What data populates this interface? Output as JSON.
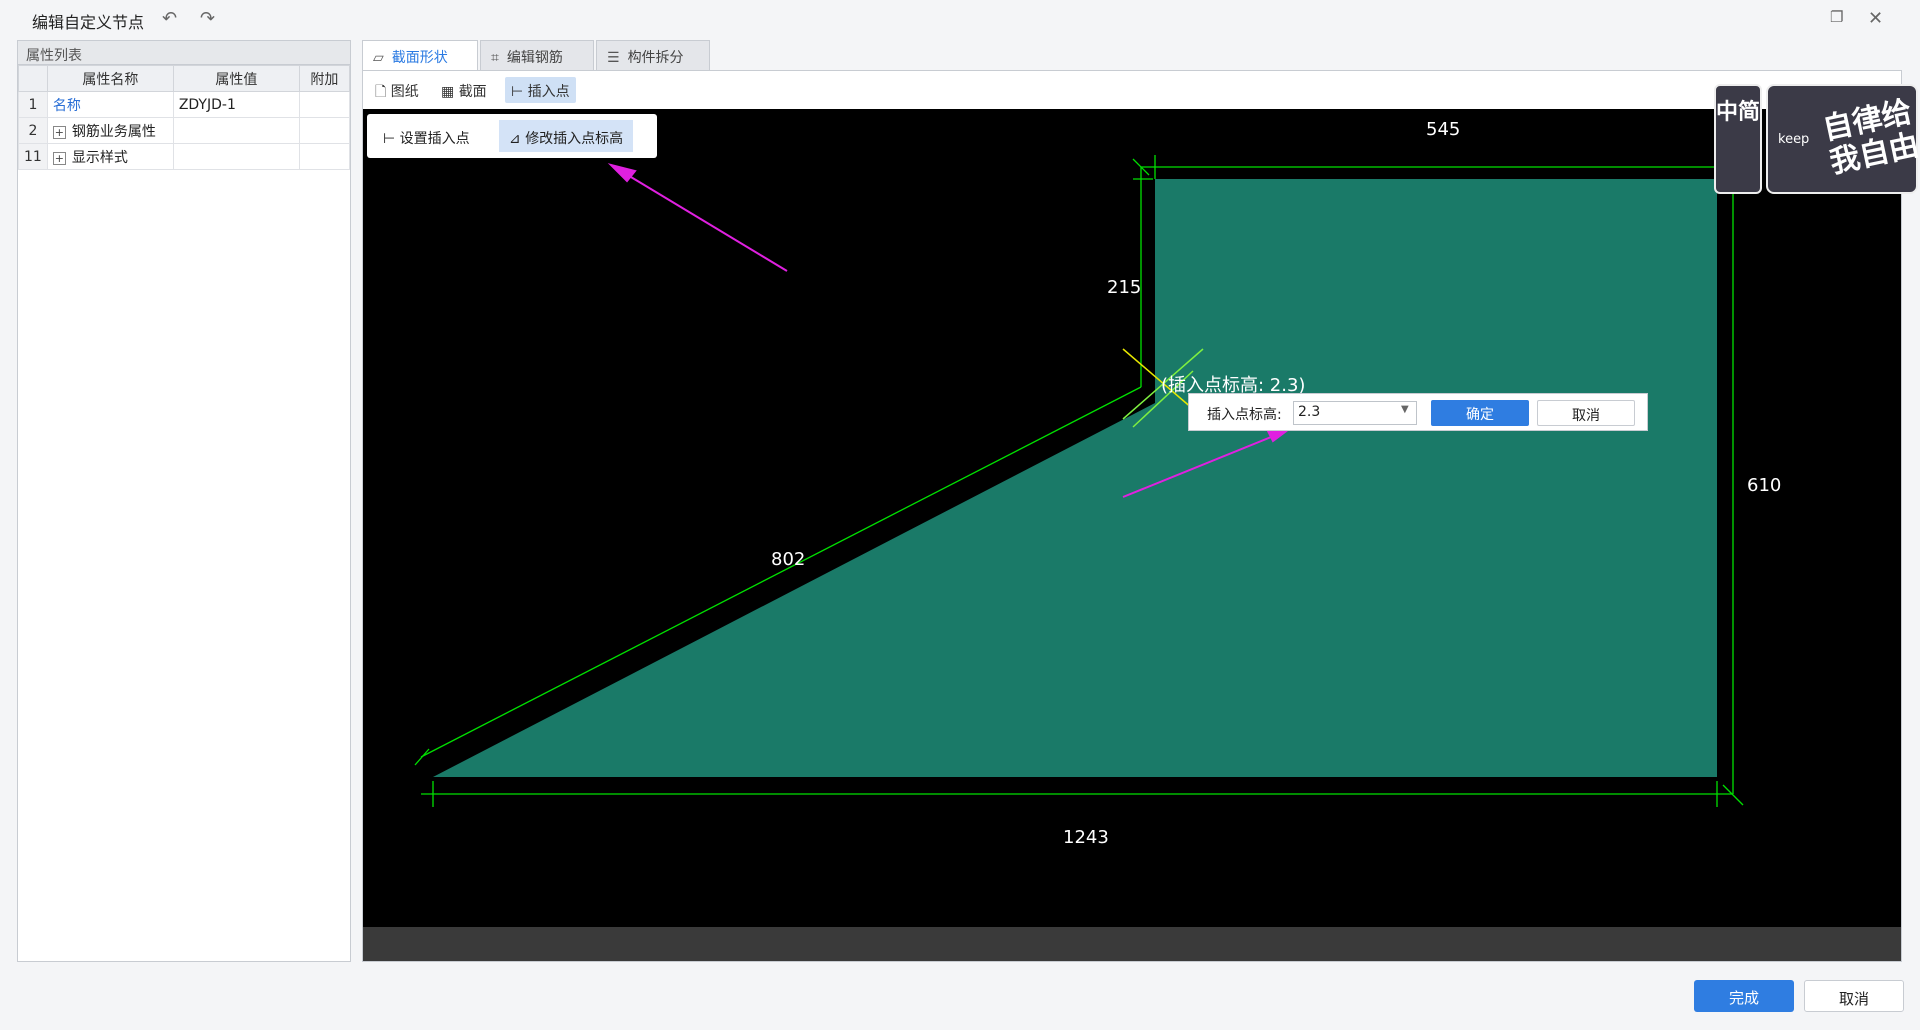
{
  "window": {
    "title": "编辑自定义节点",
    "undo_icon": "undo-icon",
    "redo_icon": "redo-icon",
    "restore_icon": "restore-icon",
    "close_icon": "close-icon"
  },
  "property_panel": {
    "title": "属性列表",
    "columns": [
      "属性名称",
      "属性值",
      "附加"
    ],
    "rows": [
      {
        "no": "1",
        "name": "名称",
        "value": "ZDYJD-1",
        "expand": ""
      },
      {
        "no": "2",
        "name": "钢筋业务属性",
        "value": "",
        "expand": "+"
      },
      {
        "no": "11",
        "name": "显示样式",
        "value": "",
        "expand": "+"
      }
    ]
  },
  "tabs": [
    {
      "label": "截面形状",
      "active": true
    },
    {
      "label": "编辑钢筋",
      "active": false
    },
    {
      "label": "构件拆分",
      "active": false
    }
  ],
  "subtoolbar": [
    {
      "label": "图纸",
      "active": false
    },
    {
      "label": "截面",
      "active": false
    },
    {
      "label": "插入点",
      "active": true
    }
  ],
  "popup_menu": {
    "set_point": "设置插入点",
    "modify_elevation": "修改插入点标高"
  },
  "elevation_box": {
    "label": "插入点标高:",
    "value": "2.3",
    "ok": "确定",
    "cancel": "取消"
  },
  "canvas": {
    "insert_point_label": "(插入点标高: 2.3)",
    "dims": {
      "top": "545",
      "left_vertical": "215",
      "right_vertical": "610",
      "slope": "802",
      "bottom": "1243"
    },
    "fill_color": "#1a7a68",
    "line_color": "#00e000"
  },
  "footer": {
    "finish": "完成",
    "cancel": "取消"
  },
  "badge": {
    "left_text": "中简",
    "keep_text": "keep",
    "big_text": "自律给我自由"
  }
}
